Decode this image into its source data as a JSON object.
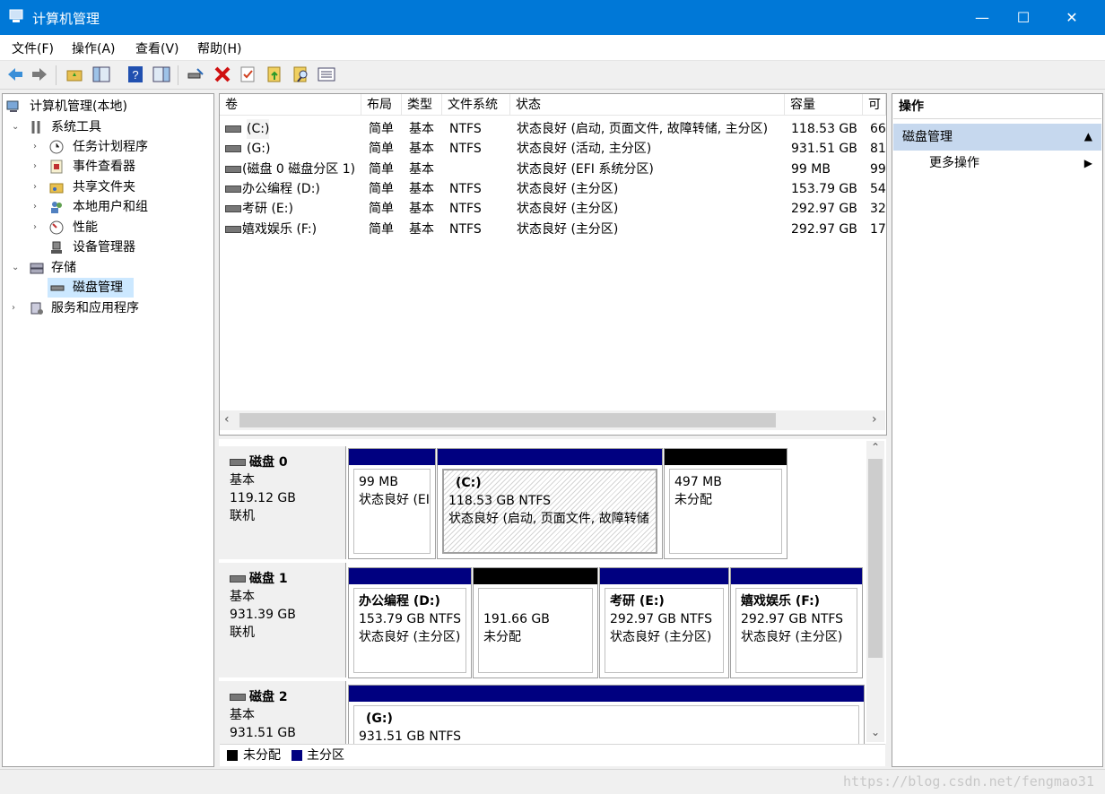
{
  "window": {
    "title": "计算机管理",
    "min": "—",
    "max": "☐",
    "close": "✕"
  },
  "menu": [
    "文件(F)",
    "操作(A)",
    "查看(V)",
    "帮助(H)"
  ],
  "tree": {
    "root": "计算机管理(本地)",
    "system_tools": "系统工具",
    "task_scheduler": "任务计划程序",
    "event_viewer": "事件查看器",
    "shared_folders": "共享文件夹",
    "local_users": "本地用户和组",
    "performance": "性能",
    "device_manager": "设备管理器",
    "storage": "存储",
    "disk_management": "磁盘管理",
    "services_apps": "服务和应用程序"
  },
  "volumes": {
    "headers": [
      "卷",
      "布局",
      "类型",
      "文件系统",
      "状态",
      "容量",
      "可"
    ],
    "rows": [
      [
        "(C:)",
        "简单",
        "基本",
        "NTFS",
        "状态良好 (启动, 页面文件, 故障转储, 主分区)",
        "118.53 GB",
        "66"
      ],
      [
        "(G:)",
        "简单",
        "基本",
        "NTFS",
        "状态良好 (活动, 主分区)",
        "931.51 GB",
        "81"
      ],
      [
        "(磁盘 0 磁盘分区 1)",
        "简单",
        "基本",
        "",
        "状态良好 (EFI 系统分区)",
        "99 MB",
        "99"
      ],
      [
        "办公编程 (D:)",
        "简单",
        "基本",
        "NTFS",
        "状态良好 (主分区)",
        "153.79 GB",
        "54"
      ],
      [
        "考研 (E:)",
        "简单",
        "基本",
        "NTFS",
        "状态良好 (主分区)",
        "292.97 GB",
        "32"
      ],
      [
        "嬉戏娱乐 (F:)",
        "简单",
        "基本",
        "NTFS",
        "状态良好 (主分区)",
        "292.97 GB",
        "17"
      ]
    ]
  },
  "disks": {
    "d0": {
      "name": "磁盘 0",
      "type": "基本",
      "size": "119.12 GB",
      "status": "联机",
      "p1": {
        "size": "99 MB",
        "status": "状态良好 (EI"
      },
      "p2": {
        "label": "(C:)",
        "size": "118.53 GB NTFS",
        "status": "状态良好 (启动, 页面文件, 故障转储"
      },
      "p3": {
        "size": "497 MB",
        "status": "未分配"
      }
    },
    "d1": {
      "name": "磁盘 1",
      "type": "基本",
      "size": "931.39 GB",
      "status": "联机",
      "p1": {
        "label": "办公编程  (D:)",
        "size": "153.79 GB NTFS",
        "status": "状态良好 (主分区)"
      },
      "p2": {
        "size": "191.66 GB",
        "status": "未分配"
      },
      "p3": {
        "label": "考研  (E:)",
        "size": "292.97 GB NTFS",
        "status": "状态良好 (主分区)"
      },
      "p4": {
        "label": "嬉戏娱乐  (F:)",
        "size": "292.97 GB NTFS",
        "status": "状态良好 (主分区)"
      }
    },
    "d2": {
      "name": "磁盘 2",
      "type": "基本",
      "size": "931.51 GB",
      "p1": {
        "label": "(G:)",
        "size": "931.51 GB NTFS"
      }
    }
  },
  "legend": {
    "unallocated": "未分配",
    "primary": "主分区"
  },
  "actions": {
    "header": "操作",
    "section": "磁盘管理",
    "more": "更多操作"
  },
  "watermark": "https://blog.csdn.net/fengmao31",
  "colors": {
    "primary": "#000080",
    "unallocated": "#000000",
    "titlebar": "#0078d7",
    "selected": "#cce8ff"
  }
}
